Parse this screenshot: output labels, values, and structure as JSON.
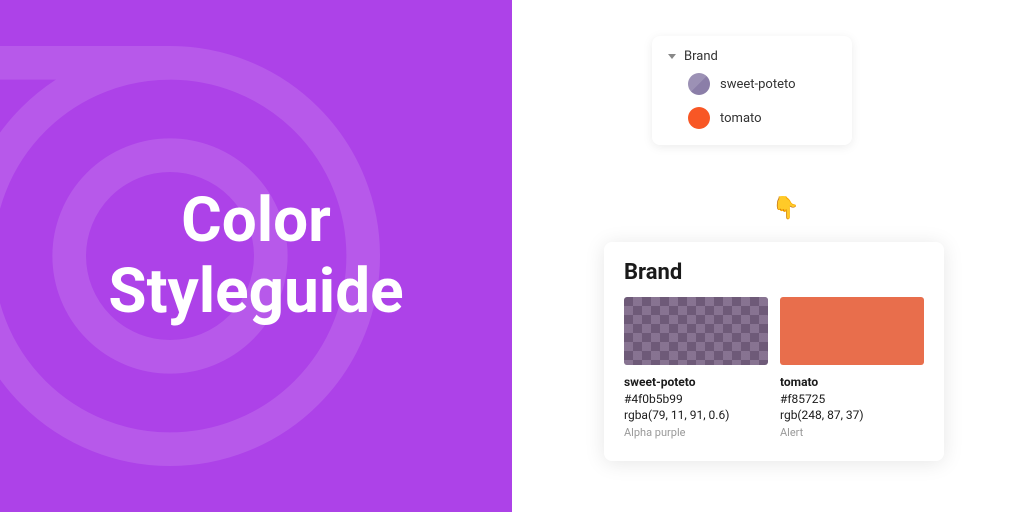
{
  "hero": {
    "title_line1": "Color",
    "title_line2": "Styleguide"
  },
  "layers": {
    "group_name": "Brand",
    "items": [
      {
        "name": "sweet-poteto"
      },
      {
        "name": "tomato"
      }
    ]
  },
  "pointer": "👇",
  "styleguide": {
    "title": "Brand",
    "swatches": [
      {
        "name": "sweet-poteto",
        "hex": "#4f0b5b99",
        "rgba": "rgba(79, 11, 91, 0.6)",
        "label": "Alpha purple"
      },
      {
        "name": "tomato",
        "hex": "#f85725",
        "rgba": "rgb(248, 87, 37)",
        "label": "Alert"
      }
    ]
  }
}
